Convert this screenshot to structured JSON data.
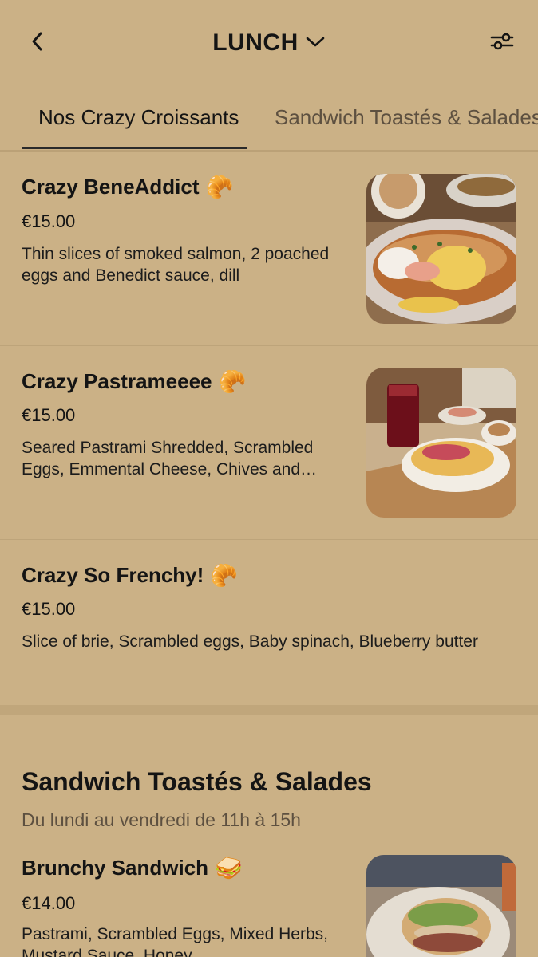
{
  "header": {
    "title": "LUNCH",
    "back_icon": "chevron-left-icon",
    "dropdown_icon": "chevron-down-icon",
    "filter_icon": "filter-sliders-icon"
  },
  "tabs": [
    {
      "label": "Nos Crazy Croissants",
      "active": true
    },
    {
      "label": "Sandwich Toastés & Salades",
      "active": false
    }
  ],
  "items": [
    {
      "name": "Crazy BeneAddict",
      "emoji": "🥐",
      "price": "€15.00",
      "description_lines": [
        "Thin slices of smoked salmon, 2 poached",
        "eggs and Benedict sauce, dill"
      ],
      "has_image": true
    },
    {
      "name": "Crazy Pastrameeee",
      "emoji": "🥐",
      "price": "€15.00",
      "description_lines": [
        "Seared Pastrami Shredded, Scrambled",
        "Eggs, Emmental Cheese, Chives and…"
      ],
      "has_image": true
    },
    {
      "name": "Crazy So Frenchy!",
      "emoji": "🥐",
      "price": "€15.00",
      "description_lines": [
        "Slice of brie, Scrambled eggs, Baby spinach, Blueberry butter"
      ],
      "has_image": false
    }
  ],
  "section": {
    "title": "Sandwich Toastés & Salades",
    "subtitle": "Du lundi au vendredi de 11h à 15h"
  },
  "section_items": [
    {
      "name": "Brunchy Sandwich",
      "emoji": "🥪",
      "price": "€14.00",
      "description_lines": [
        "Pastrami, Scrambled Eggs, Mixed Herbs,",
        "Mustard Sauce, Honey"
      ],
      "has_image": true
    }
  ],
  "colors": {
    "background": "#cbb186",
    "text": "#141414",
    "muted_text": "#5d5040",
    "divider": "#bda47a"
  }
}
